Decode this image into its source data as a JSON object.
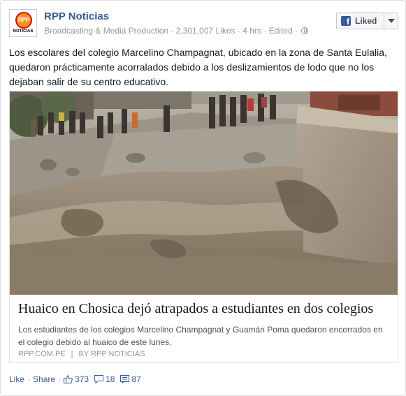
{
  "page": {
    "logo": {
      "mark": "RPP",
      "wordmark": "NOTICIAS"
    },
    "name": "RPP Noticias",
    "category": "Broadcasting & Media Production",
    "likes": "2,301,007 Likes",
    "time": "4 hrs",
    "edited": "Edited",
    "liked_button": {
      "label": "Liked",
      "icon": "facebook-f-icon",
      "brand_color": "#3b5998"
    }
  },
  "post": {
    "text": "Los escolares del colegio Marcelino Champagnat, ubicado en la zona de Santa Eulalia, quedaron prácticamente acorralados debido a los deslizamientos de lodo que no los dejaban salir de su centro educativo."
  },
  "attachment": {
    "image": "photo of a muddy flood flowing through a street with people watching",
    "title": "Huaico en Chosica dejó atrapados a estudiantes en dos colegios",
    "description": "Los estudiantes de los colegios Marcelino Champagnat y Guamán Poma quedaron encerrados en el colegio debido al huaico de este lunes.",
    "domain": "RPP.COM.PE",
    "separator": "|",
    "byline": "BY RPP NOTICIAS"
  },
  "actions": {
    "like": "Like",
    "share": "Share",
    "likes_count": "373",
    "comments_count": "18",
    "shares_count": "87"
  },
  "colors": {
    "link": "#3b5998",
    "meta": "#90949c",
    "text": "#141823"
  }
}
